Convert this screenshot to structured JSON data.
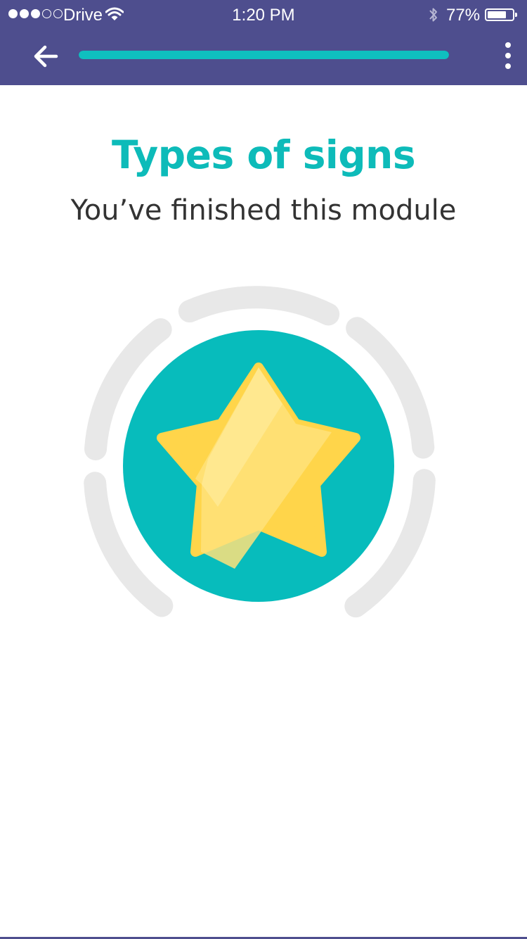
{
  "status_bar": {
    "carrier": "Drive",
    "time": "1:20 PM",
    "battery_percent": "77%",
    "battery_level": 0.77,
    "signal_bars_filled": 3,
    "signal_bars_total": 5
  },
  "header": {
    "progress": 1.0,
    "back_icon": "arrow-left-icon",
    "menu_icon": "more-vertical-icon"
  },
  "main": {
    "title": "Types of signs",
    "subtitle": "You’ve finished this module",
    "badge_icon": "star-icon"
  },
  "colors": {
    "header_bg": "#4e4e8e",
    "accent_teal": "#0dbbb9",
    "star_yellow": "#ffd54a",
    "ring_gray": "#e8e8e8"
  }
}
